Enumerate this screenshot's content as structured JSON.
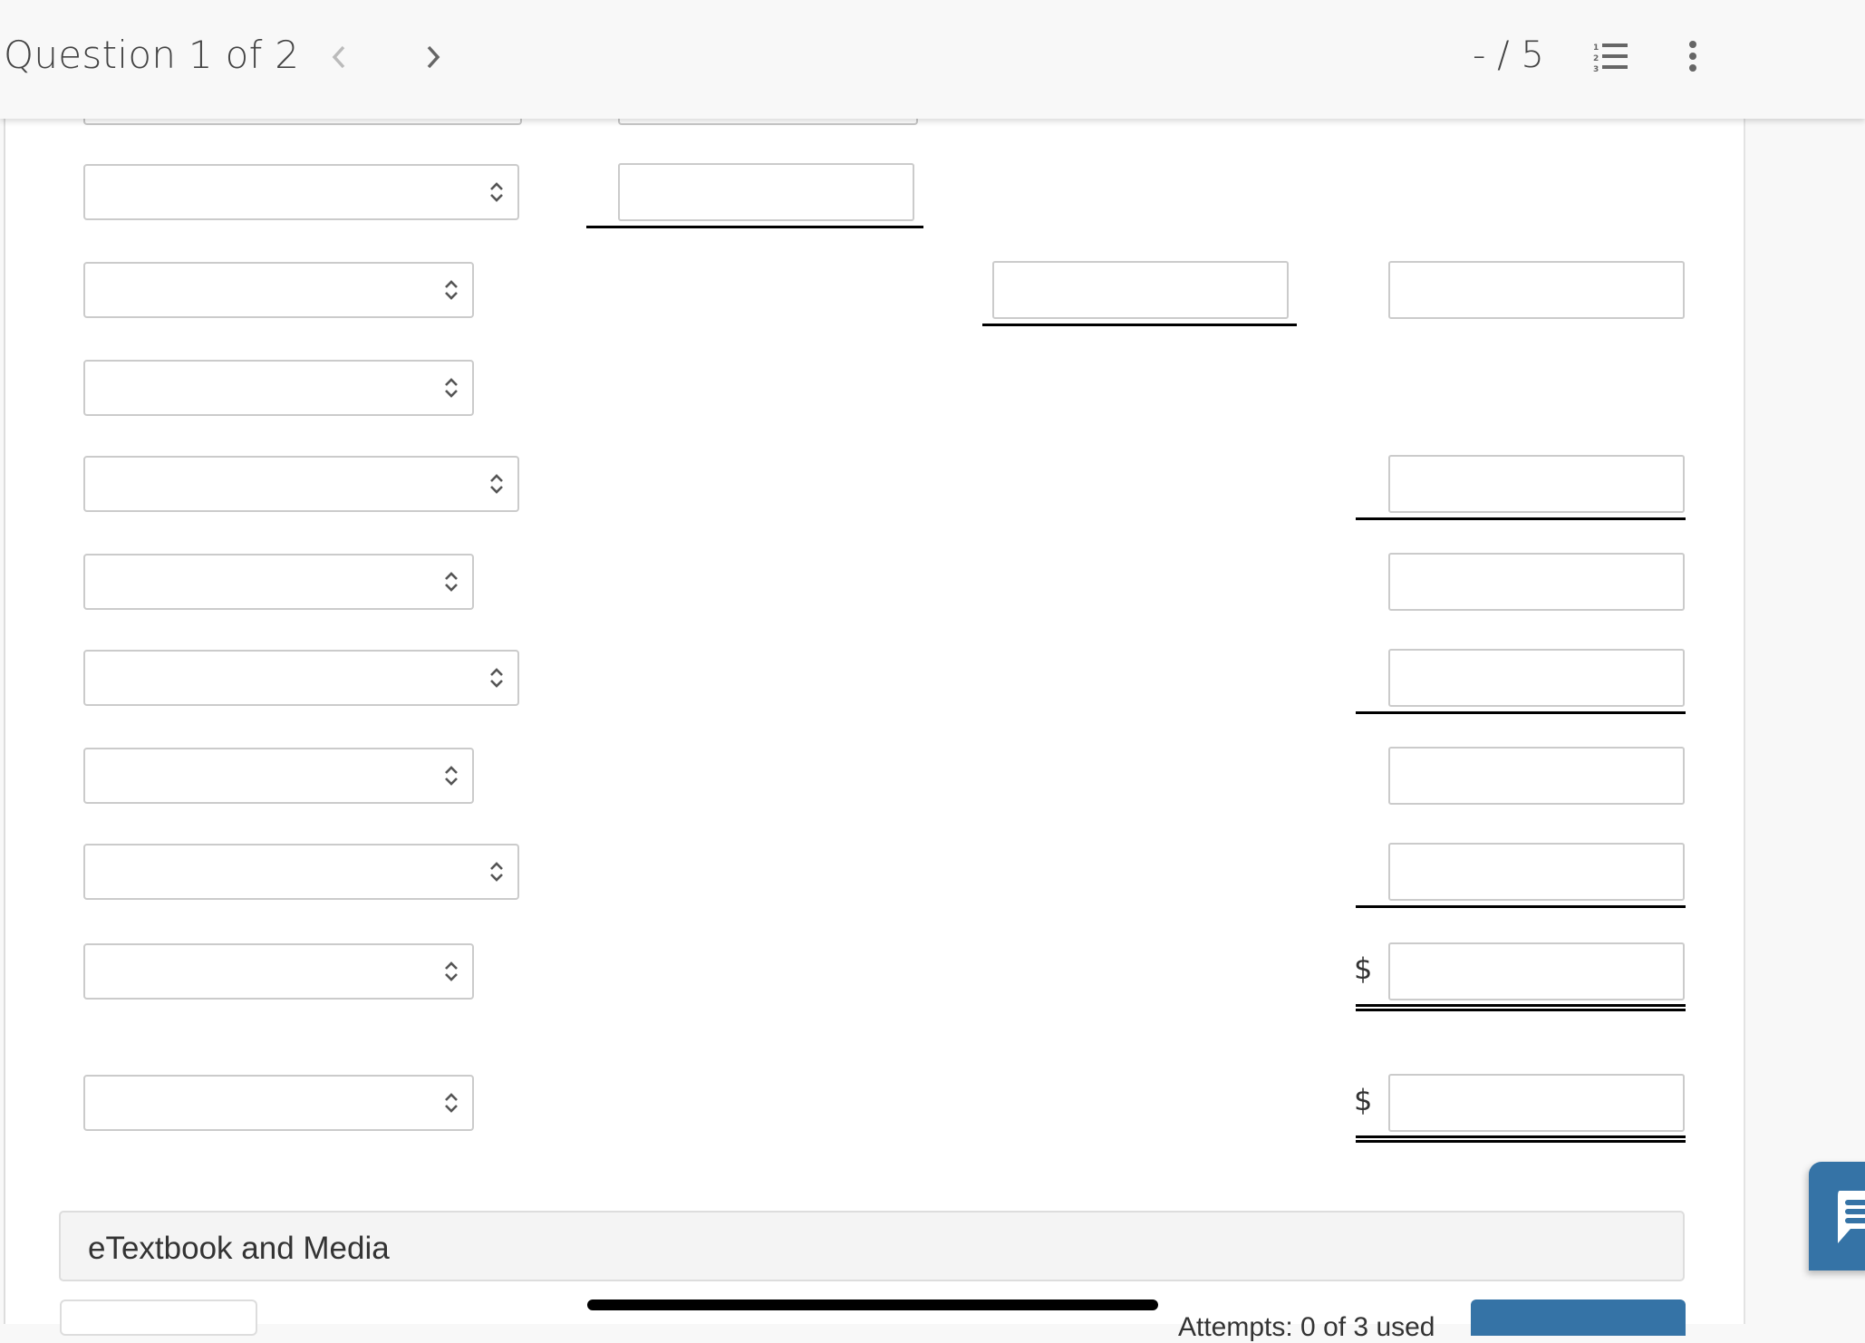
{
  "header": {
    "question_label": "Question 1 of 2",
    "prev_icon": "chevron-left-icon",
    "next_icon": "chevron-right-icon",
    "score": "- / 5",
    "question_list_icon": "numbered-list-icon",
    "more_icon": "vertical-ellipsis-icon"
  },
  "form": {
    "rows": [
      {
        "select_value": "",
        "inputs": [
          {
            "column": 1,
            "value": "",
            "underline": "single"
          }
        ]
      },
      {
        "select_value": "",
        "inputs": [
          {
            "column": 2,
            "value": "",
            "underline": "single"
          },
          {
            "column": 3,
            "value": "",
            "underline": "none"
          }
        ]
      },
      {
        "select_value": "",
        "inputs": []
      },
      {
        "select_value": "",
        "inputs": [
          {
            "column": 3,
            "value": "",
            "underline": "single"
          }
        ]
      },
      {
        "select_value": "",
        "inputs": [
          {
            "column": 3,
            "value": "",
            "underline": "none"
          }
        ]
      },
      {
        "select_value": "",
        "inputs": [
          {
            "column": 3,
            "value": "",
            "underline": "single"
          }
        ]
      },
      {
        "select_value": "",
        "inputs": [
          {
            "column": 3,
            "value": "",
            "underline": "none"
          }
        ]
      },
      {
        "select_value": "",
        "inputs": [
          {
            "column": 3,
            "value": "",
            "underline": "single"
          }
        ]
      },
      {
        "select_value": "",
        "inputs": [
          {
            "column": 3,
            "value": "",
            "underline": "double",
            "prefix": "$"
          }
        ]
      },
      {
        "select_value": "",
        "inputs": [
          {
            "column": 3,
            "value": "",
            "underline": "double",
            "prefix": "$"
          }
        ]
      }
    ],
    "currency_symbol": "$"
  },
  "footer": {
    "etextbook_label": "eTextbook and Media",
    "attempts_text": "Attempts: 0 of 3 used",
    "chat_icon": "chat-bubble-icon"
  },
  "colors": {
    "accent": "#3573a6",
    "border": "#cbcbcb",
    "header_bg": "#f8f8f8"
  }
}
